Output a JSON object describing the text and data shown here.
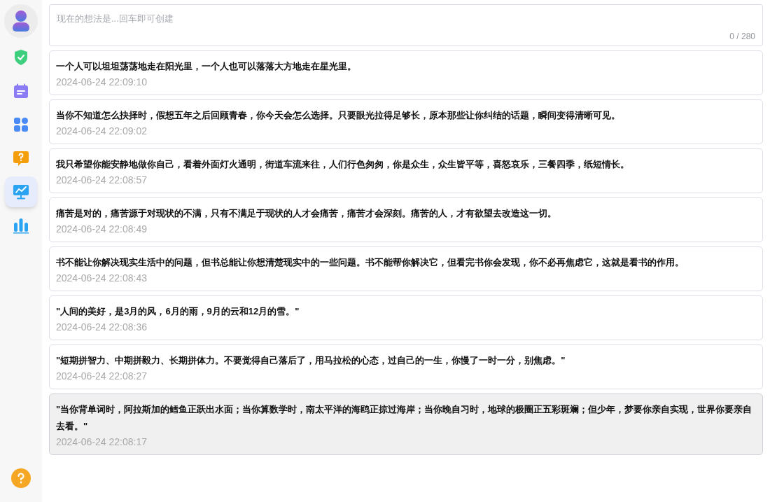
{
  "sidebar": {
    "items": [
      {
        "kind": "shield",
        "selected": false
      },
      {
        "kind": "calendar",
        "selected": false
      },
      {
        "kind": "grid",
        "selected": false
      },
      {
        "kind": "question",
        "selected": false
      },
      {
        "kind": "monitor",
        "selected": true
      },
      {
        "kind": "bars",
        "selected": false
      }
    ]
  },
  "composer": {
    "placeholder": "现在的想法是...回车即可创建",
    "counter": "0 / 280"
  },
  "posts": [
    {
      "text": "一个人可以坦坦荡荡地走在阳光里，一个人也可以落落大方地走在星光里。",
      "time": "2024-06-24 22:09:10",
      "hovered": false
    },
    {
      "text": "当你不知道怎么抉择时，假想五年之后回顾青春，你今天会怎么选择。只要眼光拉得足够长，原本那些让你纠结的话题，瞬间变得清晰可见。",
      "time": "2024-06-24 22:09:02",
      "hovered": false
    },
    {
      "text": "我只希望你能安静地做你自己，看着外面灯火通明，街道车流来往，人们行色匆匆，你是众生，众生皆平等，喜怒哀乐，三餐四季，纸短情长。",
      "time": "2024-06-24 22:08:57",
      "hovered": false
    },
    {
      "text": "痛苦是对的，痛苦源于对现状的不满，只有不满足于现状的人才会痛苦，痛苦才会深刻。痛苦的人，才有欲望去改造这一切。",
      "time": "2024-06-24 22:08:49",
      "hovered": false
    },
    {
      "text": "书不能让你解决现实生活中的问题，但书总能让你想清楚现实中的一些问题。书不能帮你解决它，但看完书你会发现，你不必再焦虑它，这就是看书的作用。",
      "time": "2024-06-24 22:08:43",
      "hovered": false
    },
    {
      "text": "\"人间的美好，是3月的风，6月的雨，9月的云和12月的雪。\"",
      "time": "2024-06-24 22:08:36",
      "hovered": false
    },
    {
      "text": "\"短期拼智力、中期拼毅力、长期拼体力。不要觉得自己落后了，用马拉松的心态，过自己的一生，你慢了一时一分，别焦虑。\"",
      "time": "2024-06-24 22:08:27",
      "hovered": false
    },
    {
      "text": "\"当你背单词时，阿拉斯加的鳕鱼正跃出水面；当你算数学时，南太平洋的海鸥正掠过海岸；当你晚自习时，地球的极圈正五彩斑斓；但少年，梦要你亲自实现，世界你要亲自去看。\"",
      "time": "2024-06-24 22:08:17",
      "hovered": true
    }
  ]
}
